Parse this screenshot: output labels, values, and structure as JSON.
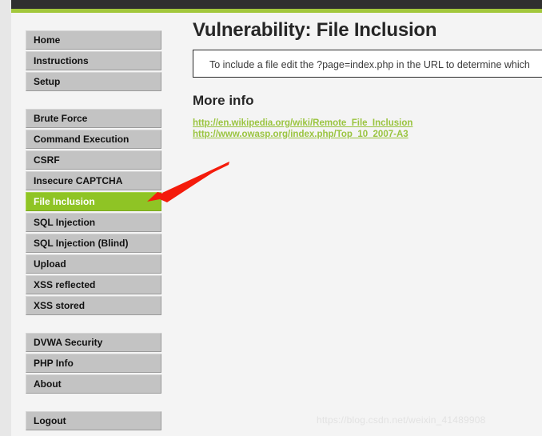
{
  "colors": {
    "header_dark": "#2f2f2f",
    "header_green": "#a2c73c",
    "accent_green": "#8fc425",
    "link_green": "#9ac43f",
    "nav_button": "#c3c3c3",
    "page_background": "#f4f4f4",
    "arrow_red": "#f41b0b"
  },
  "header": {
    "dark_bar_name": "dark-header-bar",
    "green_bar_name": "green-accent-bar"
  },
  "sidebar": {
    "groups": [
      {
        "items": [
          {
            "label": "Home",
            "active": false
          },
          {
            "label": "Instructions",
            "active": false
          },
          {
            "label": "Setup",
            "active": false
          }
        ]
      },
      {
        "items": [
          {
            "label": "Brute Force",
            "active": false
          },
          {
            "label": "Command Execution",
            "active": false
          },
          {
            "label": "CSRF",
            "active": false
          },
          {
            "label": "Insecure CAPTCHA",
            "active": false
          },
          {
            "label": "File Inclusion",
            "active": true
          },
          {
            "label": "SQL Injection",
            "active": false
          },
          {
            "label": "SQL Injection (Blind)",
            "active": false
          },
          {
            "label": "Upload",
            "active": false
          },
          {
            "label": "XSS reflected",
            "active": false
          },
          {
            "label": "XSS stored",
            "active": false
          }
        ]
      },
      {
        "items": [
          {
            "label": "DVWA Security",
            "active": false
          },
          {
            "label": "PHP Info",
            "active": false
          },
          {
            "label": "About",
            "active": false
          }
        ]
      },
      {
        "items": [
          {
            "label": "Logout",
            "active": false
          }
        ]
      }
    ]
  },
  "main": {
    "title": "Vulnerability: File Inclusion",
    "info_box_text": "To include a file edit the ?page=index.php in the URL to determine which",
    "more_info_heading": "More info",
    "links": [
      "http://en.wikipedia.org/wiki/Remote_File_Inclusion",
      "http://www.owasp.org/index.php/Top_10_2007-A3"
    ]
  },
  "annotation": {
    "arrow_name": "red-pointer-arrow",
    "points_at": "File Inclusion"
  },
  "watermark": {
    "text": "https://blog.csdn.net/weixin_41489908"
  }
}
